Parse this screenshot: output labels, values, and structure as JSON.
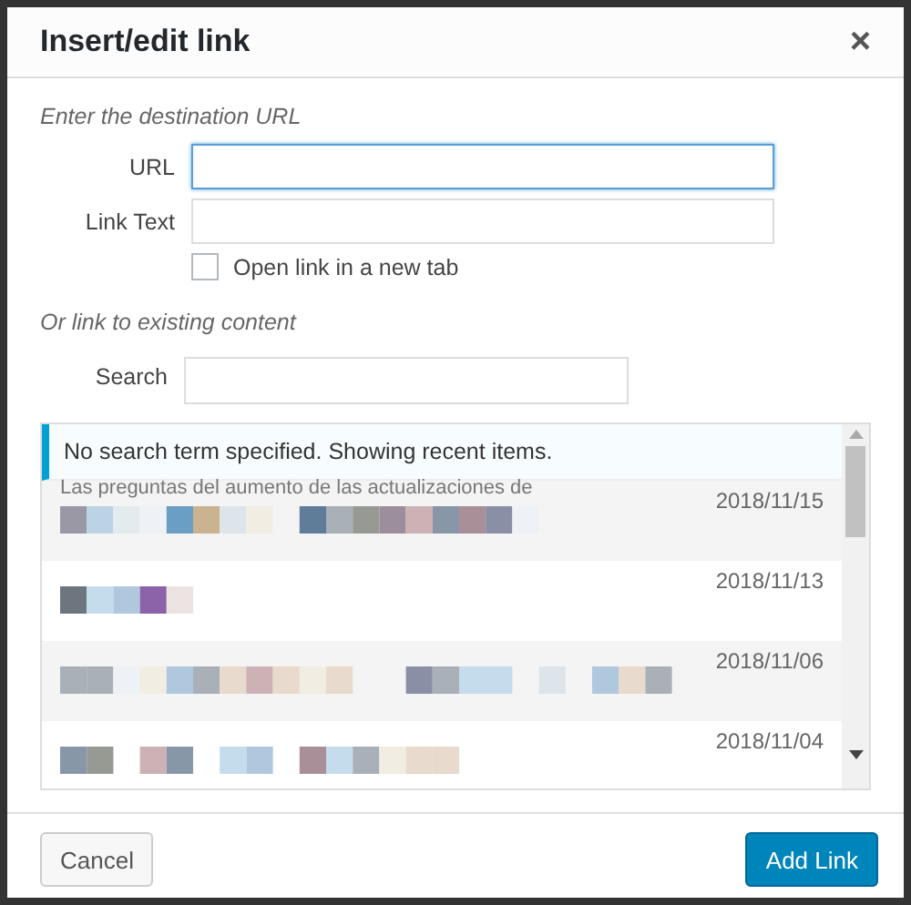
{
  "window": {
    "title": "Insert/edit link",
    "close": "×"
  },
  "destination": {
    "heading": "Enter the destination URL",
    "url": {
      "label": "URL",
      "focused": true
    },
    "link_text": {
      "label": "Link Text"
    },
    "new_tab": {
      "label": "Open link in a new tab",
      "checked": false
    }
  },
  "existing": {
    "heading": "Or link to existing content",
    "search": {
      "label": "Search"
    },
    "notice": "No search term specified. Showing recent items.",
    "results": [
      {
        "title": "Las preguntas del aumento de las actualizaciones de",
        "date": "2018/11/15"
      },
      {
        "date": "2018/11/13"
      },
      {
        "date": "2018/11/06"
      },
      {
        "date": "2018/11/04"
      }
    ]
  },
  "buttons": {
    "cancel": "Cancel",
    "submit": "Add Link"
  }
}
